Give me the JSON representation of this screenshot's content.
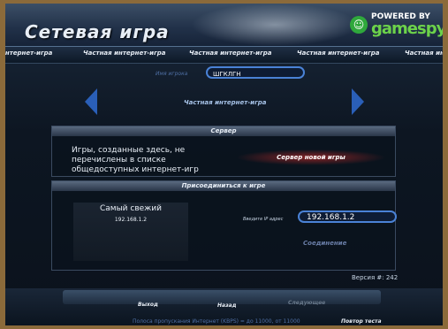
{
  "window": {
    "title": "Сетевая игра"
  },
  "brand": {
    "powered_by": "POWERED BY",
    "name": "gamespy"
  },
  "tabs": [
    {
      "label": "Интернет-игра"
    },
    {
      "label": "Частная интернет-игра"
    },
    {
      "label": "Частная интернет-игра"
    },
    {
      "label": "Частная интернет-игра"
    },
    {
      "label": "Частная инт"
    }
  ],
  "player": {
    "name_label": "Имя игрока",
    "name_value": "ШГКЛГН"
  },
  "game_mode": "Частная интернет-игра",
  "server_panel": {
    "title": "Сервер",
    "description": "Игры, созданные здесь, не перечислены в списке общедоступных интернет-игр",
    "new_server_button": "Сервер новой игры"
  },
  "join_panel": {
    "title": "Присоединиться к игре",
    "freshest_label": "Самый свежий",
    "freshest_ip": "192.168.1.2",
    "ip_label": "Введите IP адрес",
    "ip_value": "192.168.1.2",
    "connect_button": "Соединение"
  },
  "version": "Версия #: 242",
  "footer": {
    "exit": "Выход",
    "back": "Назад",
    "next": "Следующее",
    "retest": "Повтор теста",
    "status": "Полоса пропускания Интернет (KBPS) = до 11000, от 11000"
  }
}
